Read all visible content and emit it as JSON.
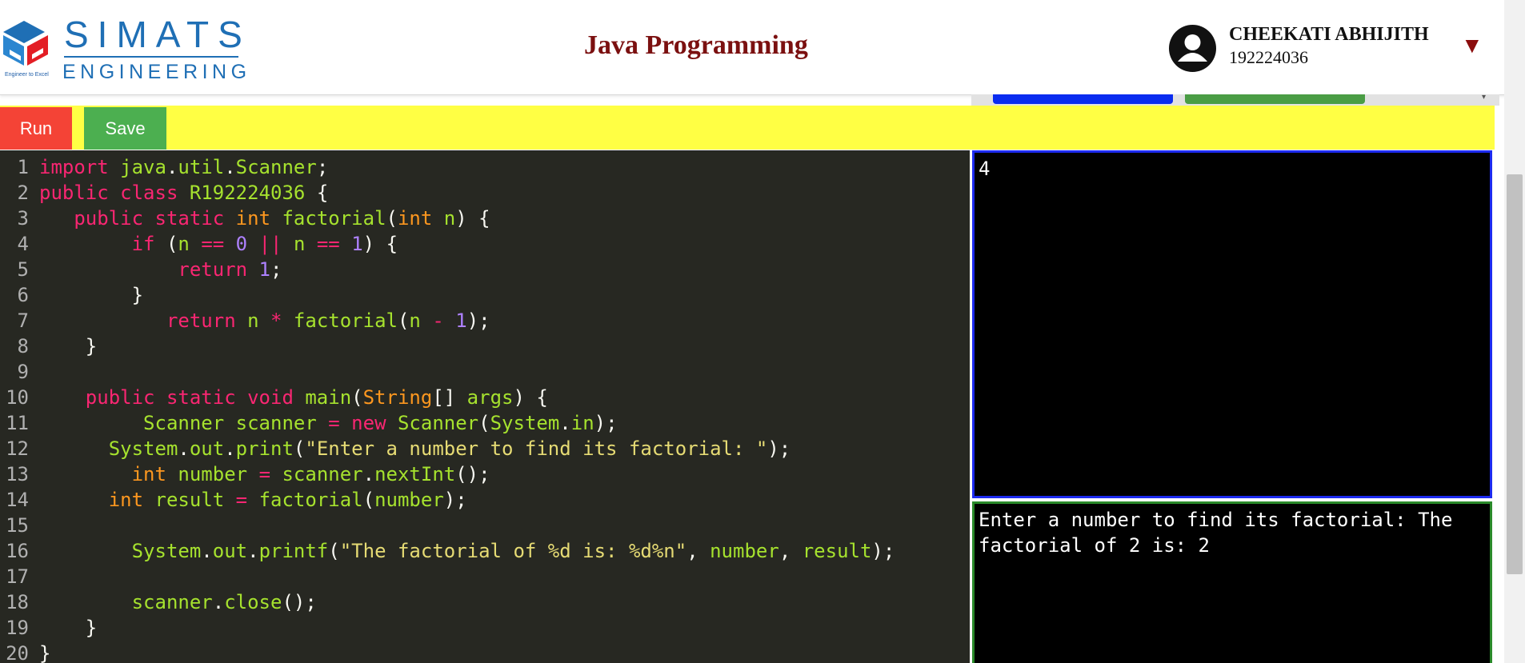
{
  "brand": {
    "name": "SIMATS",
    "subtitle": "ENGINEERING",
    "tagline": "Engineer to Excel",
    "colors": {
      "primary": "#1f6fb5",
      "accent": "#e31e25"
    }
  },
  "header": {
    "title": "Java Programming",
    "title_color": "#7b1010",
    "user": {
      "name": "CHEEKATI ABHIJITH",
      "id": "192224036",
      "menu_icon": "caret-down-icon"
    }
  },
  "toolbar": {
    "run_label": "Run",
    "save_label": "Save",
    "run_color": "#f44336",
    "save_color": "#4caf50",
    "background": "#ffff44"
  },
  "editor": {
    "language": "java",
    "line_numbers": [
      "1",
      "2",
      "3",
      "4",
      "5",
      "6",
      "7",
      "8",
      "9",
      "10",
      "11",
      "12",
      "13",
      "14",
      "15",
      "16",
      "17",
      "18",
      "19",
      "20"
    ],
    "lines": [
      "import java.util.Scanner;",
      "public class R192224036 {",
      "   public static int factorial(int n) {",
      "        if (n == 0 || n == 1) {",
      "            return 1;",
      "        }",
      "           return n * factorial(n - 1);",
      "    }",
      "",
      "    public static void main(String[] args) {",
      "         Scanner scanner = new Scanner(System.in);",
      "      System.out.print(\"Enter a number to find its factorial: \");",
      "        int number = scanner.nextInt();",
      "      int result = factorial(number);",
      "",
      "        System.out.printf(\"The factorial of %d is: %d%n\", number, result);",
      "",
      "        scanner.close();",
      "    }",
      "}"
    ]
  },
  "input_panel": {
    "text": "4",
    "border_color": "#1d2bf0"
  },
  "output_panel": {
    "text": "Enter a number to find its factorial: The factorial of 2 is: 2",
    "border_color": "#2a8a2a"
  }
}
